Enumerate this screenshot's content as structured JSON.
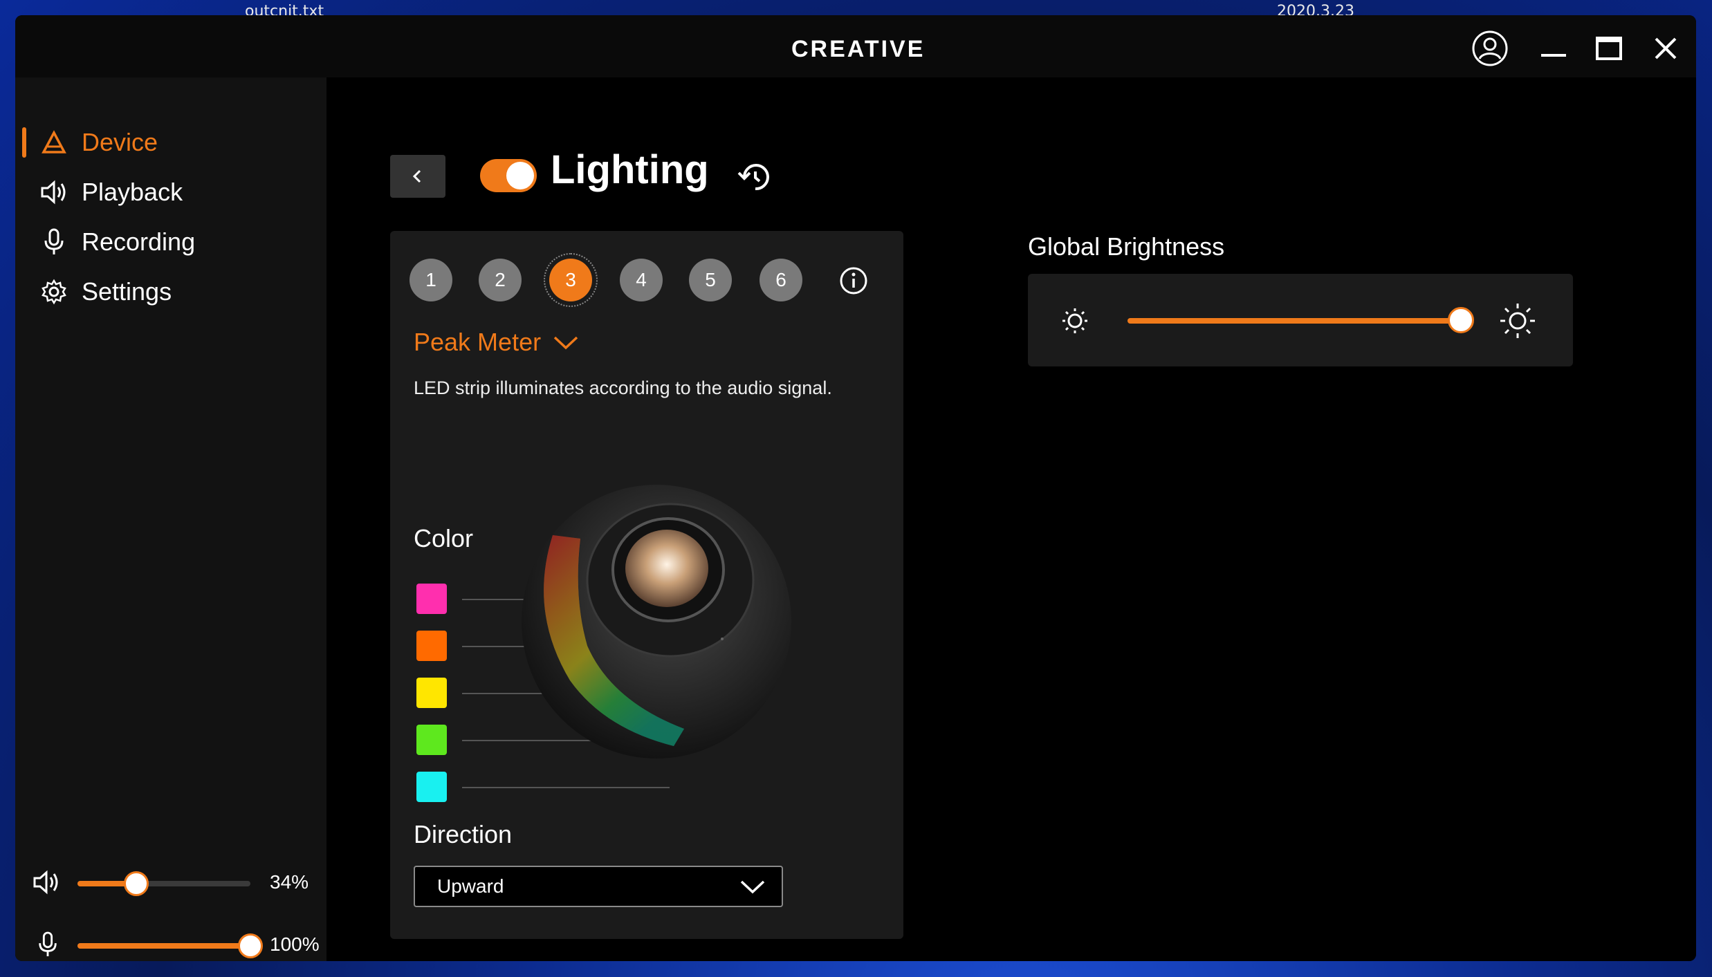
{
  "desktop": {
    "fragment_1": "outcnit.txt",
    "fragment_2": "2020.3.23"
  },
  "window": {
    "brand": "CREATIVE",
    "controls": [
      "account-icon",
      "minimize-icon",
      "maximize-icon",
      "close-icon"
    ]
  },
  "sidebar": {
    "items": [
      {
        "label": "Device",
        "icon": "device-icon",
        "active": true
      },
      {
        "label": "Playback",
        "icon": "speaker-icon",
        "active": false
      },
      {
        "label": "Recording",
        "icon": "microphone-icon",
        "active": false
      },
      {
        "label": "Settings",
        "icon": "gear-icon",
        "active": false
      }
    ],
    "volume": {
      "value": 34,
      "text": "34%"
    },
    "mic": {
      "value": 100,
      "text": "100%"
    }
  },
  "lighting": {
    "title": "Lighting",
    "enabled": true,
    "presets": [
      "1",
      "2",
      "3",
      "4",
      "5",
      "6"
    ],
    "active_preset": "3",
    "effect": "Peak Meter",
    "description": "LED strip illuminates according to the audio signal.",
    "color_label": "Color",
    "colors": [
      "#ff2fae",
      "#ff6a00",
      "#ffe600",
      "#5ee81e",
      "#19f0f0"
    ],
    "direction_label": "Direction",
    "direction_value": "Upward"
  },
  "brightness": {
    "label": "Global Brightness",
    "value": 100
  },
  "accent": "#f07a1a"
}
